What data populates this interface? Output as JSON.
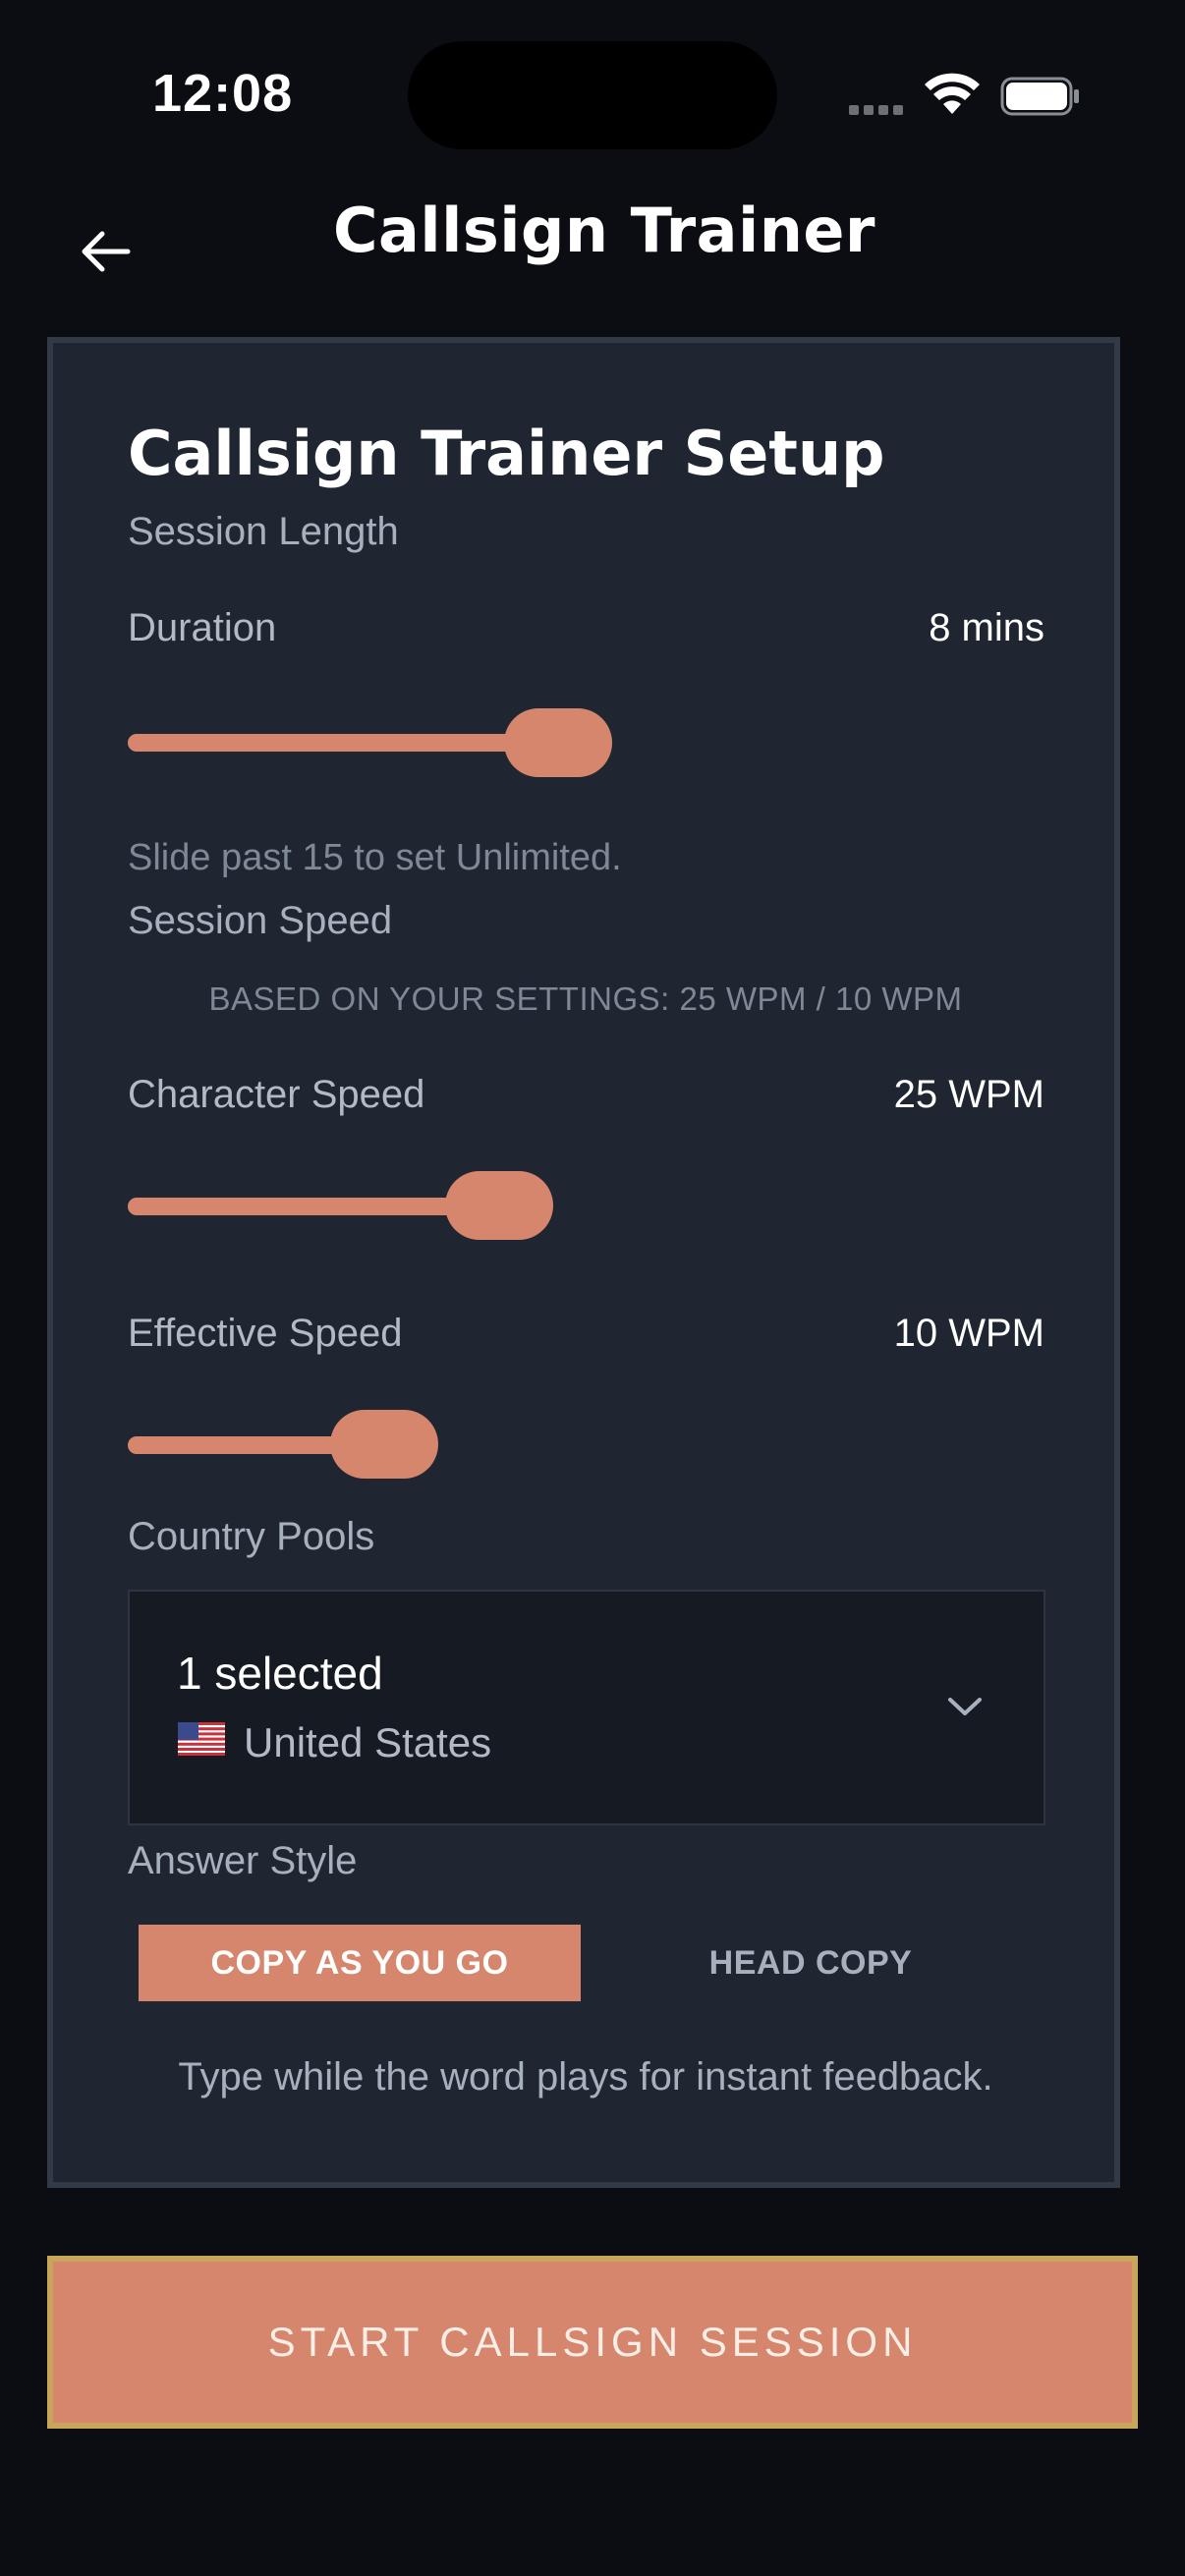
{
  "status_bar": {
    "time": "12:08"
  },
  "nav": {
    "title": "Callsign Trainer"
  },
  "card": {
    "title": "Callsign Trainer Setup",
    "session_length": {
      "section": "Session Length",
      "duration_label": "Duration",
      "duration_value": "8 mins",
      "duration_fraction": 0.5,
      "hint": "Slide past 15 to set Unlimited."
    },
    "session_speed": {
      "section": "Session Speed",
      "note": "BASED ON YOUR SETTINGS: 25 WPM / 10 WPM",
      "character_label": "Character Speed",
      "character_value": "25 WPM",
      "effective_label": "Effective Speed",
      "effective_value": "10 WPM"
    },
    "country_pools": {
      "section": "Country Pools",
      "selected_count": "1 selected",
      "countries": [
        "United States"
      ],
      "flag_icon": "us-flag-icon"
    },
    "answer_style": {
      "section": "Answer Style",
      "options": [
        "COPY AS YOU GO",
        "HEAD COPY"
      ],
      "selected": "COPY AS YOU GO",
      "hint": "Type while the word plays for instant feedback."
    }
  },
  "start_button": {
    "label": "START CALLSIGN SESSION"
  },
  "colors": {
    "background": "#0b0d12",
    "card": "#1f2631",
    "accent": "#d5866d",
    "button_border": "#c7a55b"
  }
}
